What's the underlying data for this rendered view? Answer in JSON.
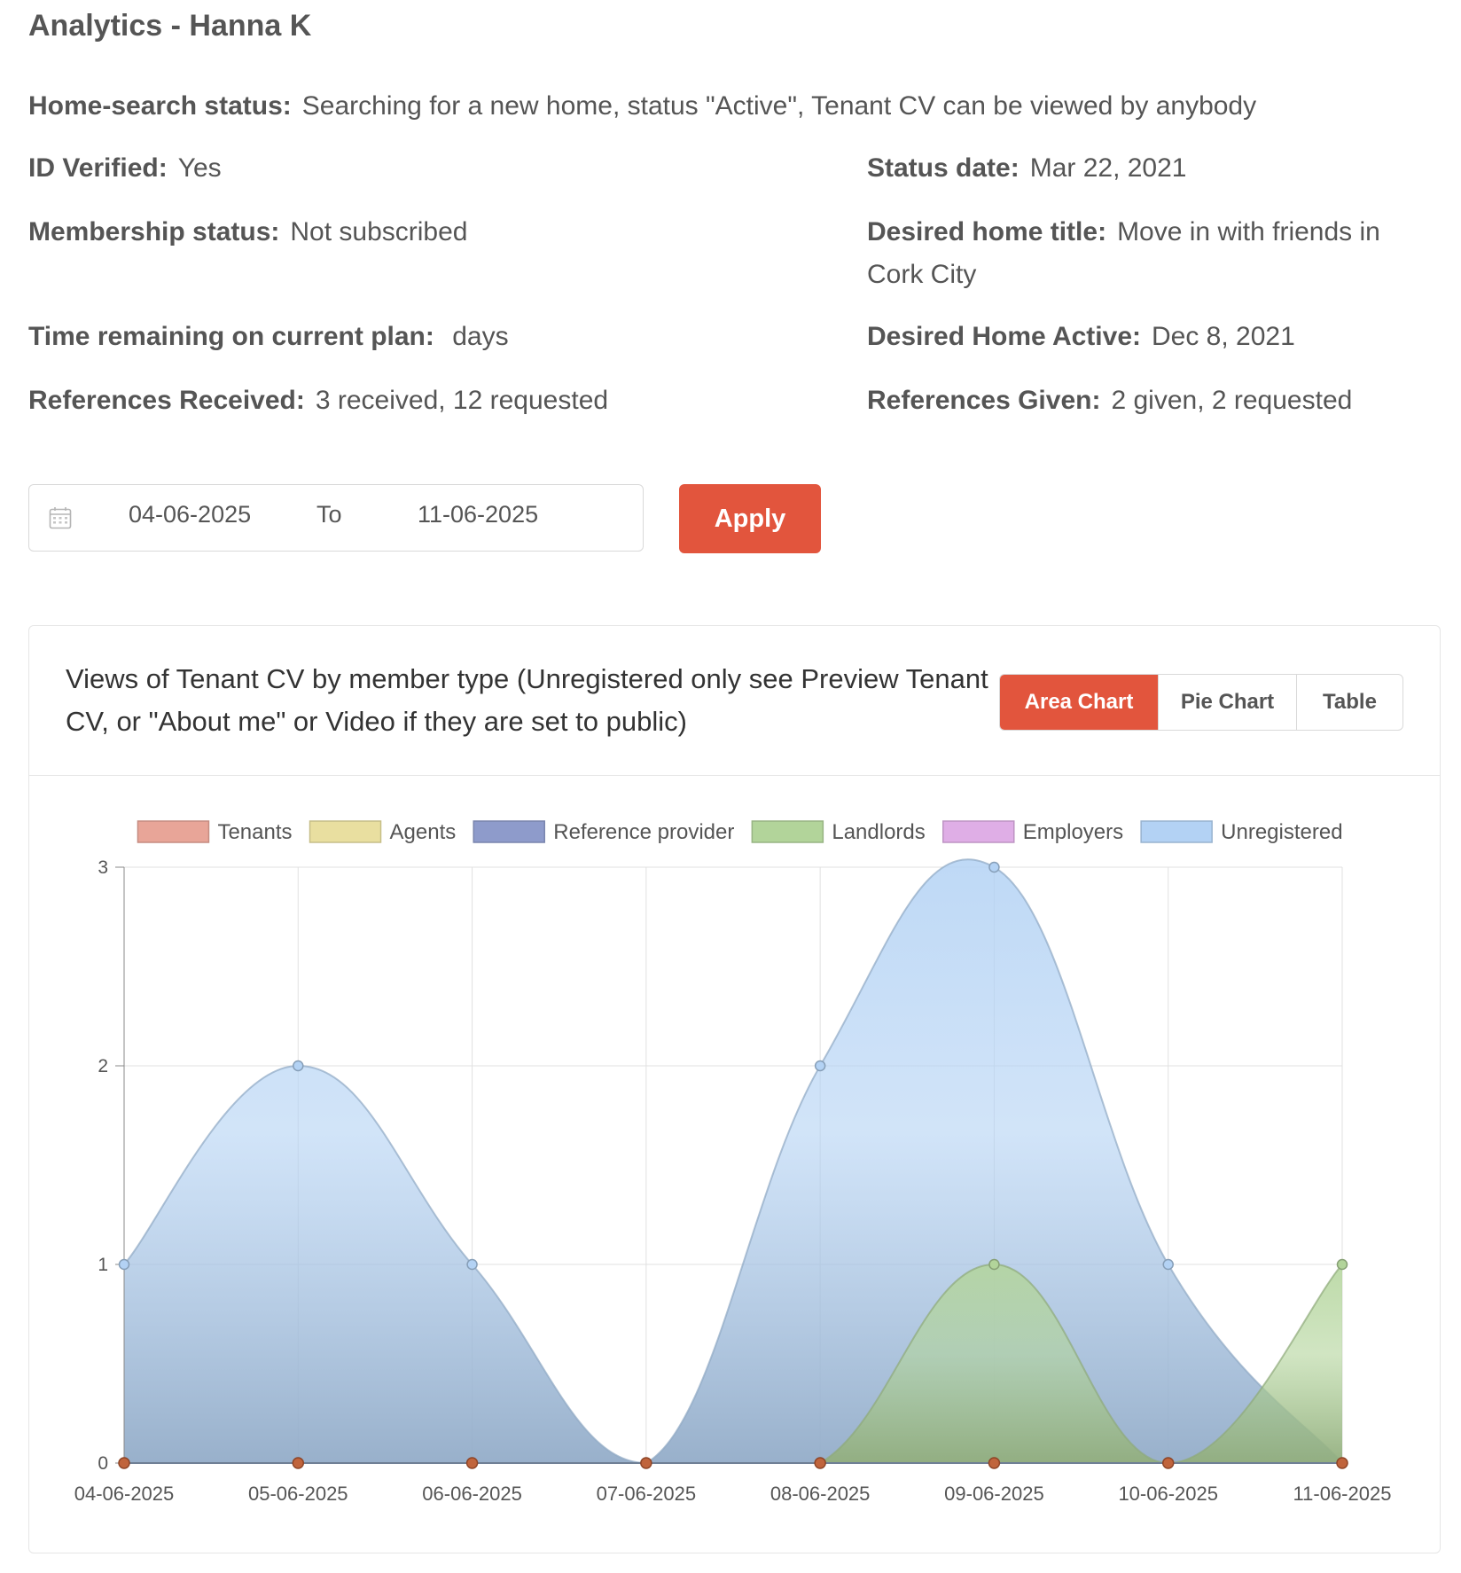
{
  "page": {
    "title": "Analytics - Hanna K"
  },
  "profile": {
    "home_search_status": {
      "label": "Home-search status:",
      "value": "Searching for a new home, status \"Active\", Tenant CV can be viewed by anybody"
    },
    "id_verified": {
      "label": "ID Verified:",
      "value": "Yes"
    },
    "status_date": {
      "label": "Status date:",
      "value": "Mar 22, 2021"
    },
    "membership_status": {
      "label": "Membership status:",
      "value": "Not subscribed"
    },
    "desired_home_title": {
      "label": "Desired home title:",
      "value": "Move in with friends in",
      "value_line2": "Cork City"
    },
    "time_remaining": {
      "label": "Time remaining on current plan:",
      "value": "days"
    },
    "desired_home_active": {
      "label": "Desired Home Active:",
      "value": "Dec 8, 2021"
    },
    "references_received": {
      "label": "References Received:",
      "value": "3 received, 12 requested"
    },
    "references_given": {
      "label": "References Given:",
      "value": "2 given, 2 requested"
    }
  },
  "date_filter": {
    "icon": "calendar-icon",
    "from": "04-06-2025",
    "separator": "To",
    "to": "11-06-2025",
    "apply_label": "Apply",
    "apply_color": "#e2553d"
  },
  "card": {
    "title": "Views of Tenant CV by member type (Unregistered only see Preview Tenant CV, or \"About me\" or Video if they are set to public)",
    "tabs": [
      {
        "label": "Area Chart",
        "active": true
      },
      {
        "label": "Pie Chart",
        "active": false
      },
      {
        "label": "Table",
        "active": false
      }
    ]
  },
  "chart_data": {
    "type": "area",
    "categories": [
      "04-06-2025",
      "05-06-2025",
      "06-06-2025",
      "07-06-2025",
      "08-06-2025",
      "09-06-2025",
      "10-06-2025",
      "11-06-2025"
    ],
    "ylim": [
      0,
      3
    ],
    "yticks": [
      0,
      1,
      2,
      3
    ],
    "grid": true,
    "legend_position": "top",
    "series": [
      {
        "name": "Tenants",
        "color": "#e8a598",
        "values": [
          0,
          0,
          0,
          0,
          0,
          0,
          0,
          0
        ]
      },
      {
        "name": "Agents",
        "color": "#e9dfa0",
        "values": [
          0,
          0,
          0,
          0,
          0,
          0,
          0,
          0
        ]
      },
      {
        "name": "Reference provider",
        "color": "#8e9bcb",
        "values": [
          0,
          0,
          0,
          0,
          0,
          0,
          0,
          0
        ]
      },
      {
        "name": "Landlords",
        "color": "#b2d49a",
        "values": [
          0,
          0,
          0,
          0,
          0,
          1,
          0,
          1
        ]
      },
      {
        "name": "Employers",
        "color": "#dfaee6",
        "values": [
          0,
          0,
          0,
          0,
          0,
          0,
          0,
          0
        ]
      },
      {
        "name": "Unregistered",
        "color": "#b3d2f4",
        "values": [
          1,
          2,
          1,
          0,
          2,
          3,
          1,
          0
        ]
      }
    ]
  }
}
